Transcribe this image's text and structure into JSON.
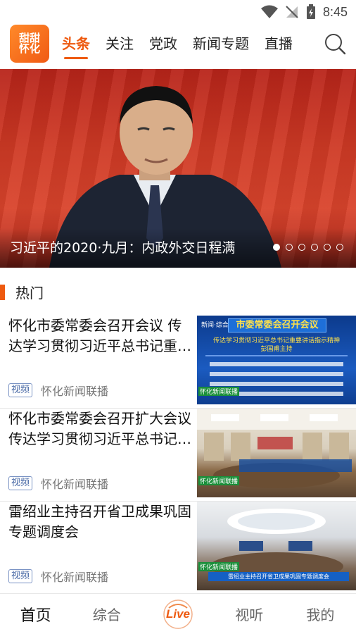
{
  "status_bar": {
    "time": "8:45"
  },
  "header": {
    "logo_line1": "甜甜",
    "logo_line2": "怀化",
    "tabs": [
      {
        "label": "头条",
        "active": true
      },
      {
        "label": "关注"
      },
      {
        "label": "党政"
      },
      {
        "label": "新闻专题"
      },
      {
        "label": "直播"
      }
    ]
  },
  "banner": {
    "title": "习近平的2020·九月：内政外交日程满",
    "slide_count": 6,
    "active_slide": 1
  },
  "section": {
    "title": "热门"
  },
  "news": [
    {
      "title": "怀化市委常委会召开会议 传达学习贯彻习近平总书记重要讲话指示精神",
      "badge": "视频",
      "source": "怀化新闻联播",
      "thumb_heading": "市委常委会召开会议",
      "thumb_sub": "传达学习贯彻习近平总书记重要讲话指示精神",
      "thumb_host": "彭国甫主持",
      "thumb_tag": "新闻·综合",
      "thumb_logo": "怀化新闻联播"
    },
    {
      "title": "怀化市委常委会召开扩大会议 传达学习贯彻习近平总书记重要讲话精神",
      "badge": "视频",
      "source": "怀化新闻联播",
      "thumb_logo": "怀化新闻联播"
    },
    {
      "title": "雷绍业主持召开省卫成果巩固专题调度会",
      "badge": "视频",
      "source": "怀化新闻联播",
      "thumb_caption": "雷绍业主持召开省卫成果巩固专题调度会",
      "thumb_logo": "怀化新闻联播"
    }
  ],
  "bottom_nav": [
    {
      "label": "首页",
      "active": true
    },
    {
      "label": "综合"
    },
    {
      "label": "Live"
    },
    {
      "label": "视听"
    },
    {
      "label": "我的"
    }
  ],
  "colors": {
    "accent": "#ee5a10",
    "badge": "#4a6aa6"
  }
}
